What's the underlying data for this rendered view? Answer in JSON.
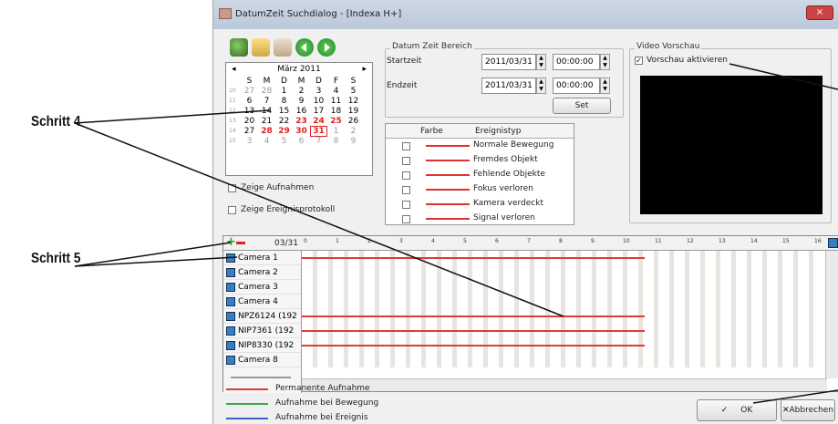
{
  "annotations": {
    "step4": "Schritt 4",
    "step5": "Schritt 5"
  },
  "dialog": {
    "title": "DatumZeit Suchdialog - [Indexa H+]",
    "close_glyph": "×"
  },
  "toolbar": {
    "icons": [
      "find-icon",
      "event-icon",
      "export-icon",
      "back-icon",
      "forward-icon"
    ]
  },
  "calendar": {
    "month": "März 2011",
    "prev": "◂",
    "next": "▸",
    "weekdays": [
      "S",
      "M",
      "D",
      "M",
      "D",
      "F",
      "S"
    ],
    "weeks": [
      {
        "wk": "10",
        "days": [
          "27",
          "28",
          "1",
          "2",
          "3",
          "4",
          "5"
        ]
      },
      {
        "wk": "11",
        "days": [
          "6",
          "7",
          "8",
          "9",
          "10",
          "11",
          "12"
        ]
      },
      {
        "wk": "12",
        "days": [
          "13",
          "14",
          "15",
          "16",
          "17",
          "18",
          "19"
        ]
      },
      {
        "wk": "13",
        "days": [
          "20",
          "21",
          "22",
          "23",
          "24",
          "25",
          "26"
        ]
      },
      {
        "wk": "14",
        "days": [
          "27",
          "28",
          "29",
          "30",
          "31",
          "1",
          "2"
        ]
      },
      {
        "wk": "15",
        "days": [
          "3",
          "4",
          "5",
          "6",
          "7",
          "8",
          "9"
        ]
      }
    ]
  },
  "options": {
    "show_recordings": "Zeige Aufnahmen",
    "show_event_log": "Zeige Ereignisprotokoll"
  },
  "datetime_range": {
    "group_title": "Datum Zeit Bereich",
    "start_label": "Startzeit",
    "end_label": "Endzeit",
    "start_date": "2011/03/31",
    "start_time": "00:00:00",
    "end_date": "2011/03/31",
    "end_time": "00:00:00",
    "set_button": "Set"
  },
  "event_table": {
    "col_color": "Farbe",
    "col_type": "Ereignistyp",
    "rows": [
      "Normale Bewegung",
      "Fremdes Objekt",
      "Fehlende Objekte",
      "Fokus verloren",
      "Kamera verdeckt",
      "Signal verloren"
    ]
  },
  "video_preview": {
    "group_title": "Video Vorschau",
    "enable_label": "Vorschau aktivieren",
    "checkmark": "✓"
  },
  "timeline": {
    "date": "03/31",
    "hours": [
      "0",
      "1",
      "2",
      "3",
      "4",
      "5",
      "6",
      "7",
      "8",
      "9",
      "10",
      "11",
      "12",
      "13",
      "14",
      "15",
      "16"
    ],
    "cameras": [
      "Camera 1",
      "Camera 2",
      "Camera 3",
      "Camera 4",
      "NPZ6124 (192",
      "NIP7361 (192",
      "NIP8330 (192",
      "Camera 8"
    ],
    "recording_rows": [
      0,
      4,
      5,
      6
    ]
  },
  "legend": {
    "permanent": "Permanente Aufnahme",
    "motion": "Aufnahme bei Bewegung",
    "event": "Aufnahme bei Ereignis",
    "colors": {
      "permanent": "#e03a3a",
      "motion": "#3aa84a",
      "event": "#3a62c8"
    }
  },
  "buttons": {
    "ok": "OK",
    "cancel": "Abbrechen"
  }
}
